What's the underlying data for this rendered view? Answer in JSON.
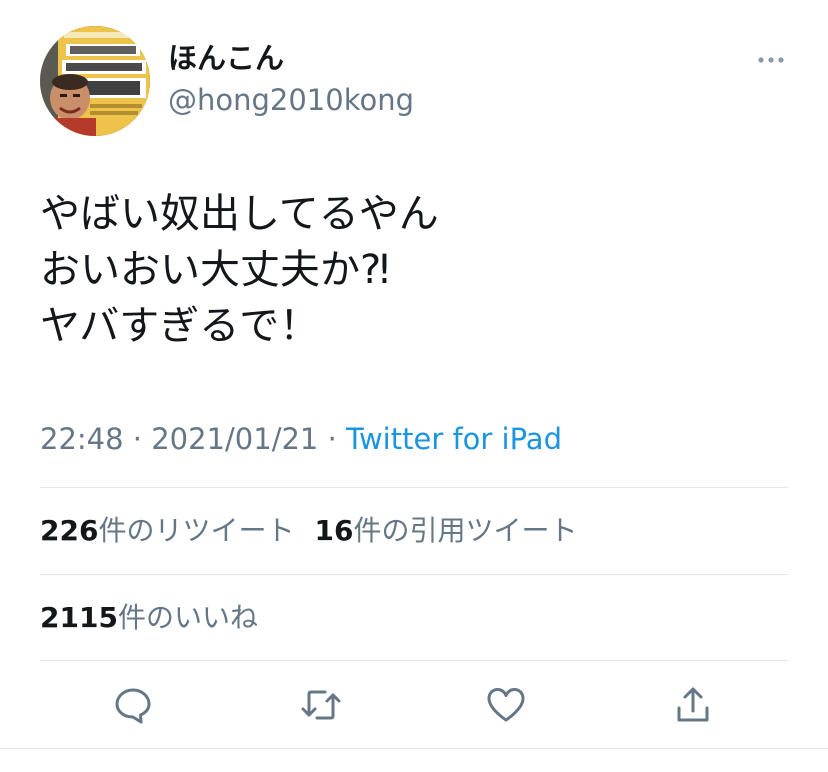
{
  "user": {
    "display_name": "ほんこん",
    "handle": "@hong2010kong"
  },
  "tweet": {
    "lines": [
      "やばい奴出してるやん",
      "おいおい大丈夫か⁈",
      "ヤバすぎるで！"
    ],
    "time": "22:48",
    "date": "2021/01/21",
    "separator": "·",
    "source": "Twitter for iPad"
  },
  "stats": {
    "retweets_count": "226",
    "retweets_label": "件のリツイート",
    "quotes_count": "16",
    "quotes_label": "件の引用ツイート",
    "likes_count": "2115",
    "likes_label": "件のいいね"
  },
  "colors": {
    "text_primary": "#14171a",
    "text_secondary": "#657786",
    "link": "#1b95e0",
    "divider": "#e1e8ed"
  },
  "icons": {
    "more": "more-dots-icon",
    "reply": "reply-bubble-icon",
    "retweet": "retweet-arrows-icon",
    "like": "heart-icon",
    "share": "share-upload-icon"
  }
}
